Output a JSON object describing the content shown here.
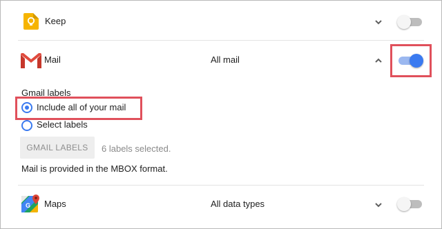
{
  "services": {
    "keep": {
      "label": "Keep",
      "enabled": false
    },
    "mail": {
      "label": "Mail",
      "detail": "All mail",
      "enabled": true
    },
    "maps": {
      "label": "Maps",
      "detail": "All data types",
      "enabled": false
    }
  },
  "mail_options": {
    "section_label": "Gmail labels",
    "option_all": "Include all of your mail",
    "option_select": "Select labels",
    "selected_option": "Include all of your mail",
    "labels_button": "GMAIL LABELS",
    "labels_selected": "6 labels selected.",
    "format_note": "Mail is provided in the MBOX format."
  },
  "colors": {
    "accent": "#3a7af0",
    "highlight": "#e0505b",
    "keep_yellow": "#f6b400",
    "gmail_red": "#d93025"
  }
}
